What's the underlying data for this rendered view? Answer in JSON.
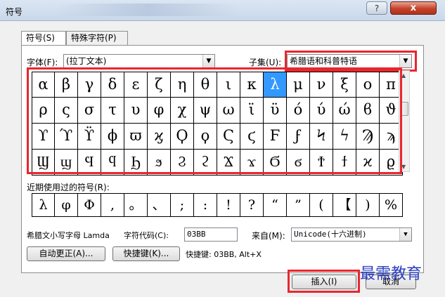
{
  "window": {
    "title": "符号",
    "help_glyph": "?",
    "close_glyph": "x"
  },
  "tabs": [
    {
      "label": "符号(S)",
      "active": true
    },
    {
      "label": "特殊字符(P)",
      "active": false
    }
  ],
  "font": {
    "label": "字体(F):",
    "value": "(拉丁文本)"
  },
  "subset": {
    "label": "子集(U):",
    "value": "希腊语和科普特语"
  },
  "symbols": [
    [
      "α",
      "β",
      "γ",
      "δ",
      "ε",
      "ζ",
      "η",
      "θ",
      "ι",
      "κ",
      "λ",
      "μ",
      "ν",
      "ξ",
      "ο",
      "π"
    ],
    [
      "ρ",
      "ς",
      "σ",
      "τ",
      "υ",
      "φ",
      "χ",
      "ψ",
      "ω",
      "ϊ",
      "ϋ",
      "ό",
      "ύ",
      "ώ",
      "ϐ",
      "ϑ"
    ],
    [
      "ϒ",
      "ϓ",
      "ϔ",
      "ϕ",
      "ϖ",
      "ϗ",
      "Ϙ",
      "ϙ",
      "Ϛ",
      "ϛ",
      "Ϝ",
      "ϝ",
      "Ϟ",
      "ϟ",
      "Ϡ",
      "ϡ"
    ],
    [
      "Ϣ",
      "ϣ",
      "Ϥ",
      "ϥ",
      "Ϧ",
      "ϧ",
      "Ϩ",
      "ϩ",
      "Ϫ",
      "ϫ",
      "Ϭ",
      "ϭ",
      "Ϯ",
      "ϯ",
      "ϰ",
      "ϱ"
    ]
  ],
  "selected_symbol": "λ",
  "recent": {
    "label": "近期使用过的符号(R):",
    "symbols": [
      "λ",
      "φ",
      "Φ",
      ",",
      "。",
      "、",
      ";",
      ":",
      "!",
      "?",
      "“",
      "”",
      "(",
      "【",
      ")",
      "%"
    ]
  },
  "char_info": {
    "name": "希腊文小写字母 Lamda",
    "code_label": "字符代码(C):",
    "code_value": "03BB",
    "from_label": "来自(M):",
    "from_value": "Unicode(十六进制)"
  },
  "buttons": {
    "autocorrect": "自动更正(A)...",
    "shortcut": "快捷键(K)...",
    "insert": "插入(I)",
    "cancel": "取消"
  },
  "shortcut_text": "快捷键: 03BB, Alt+X",
  "watermark": "最需教育",
  "colors": {
    "highlight": "#e8262e",
    "selection": "#3399ff",
    "watermark": "#2b3fc2"
  }
}
